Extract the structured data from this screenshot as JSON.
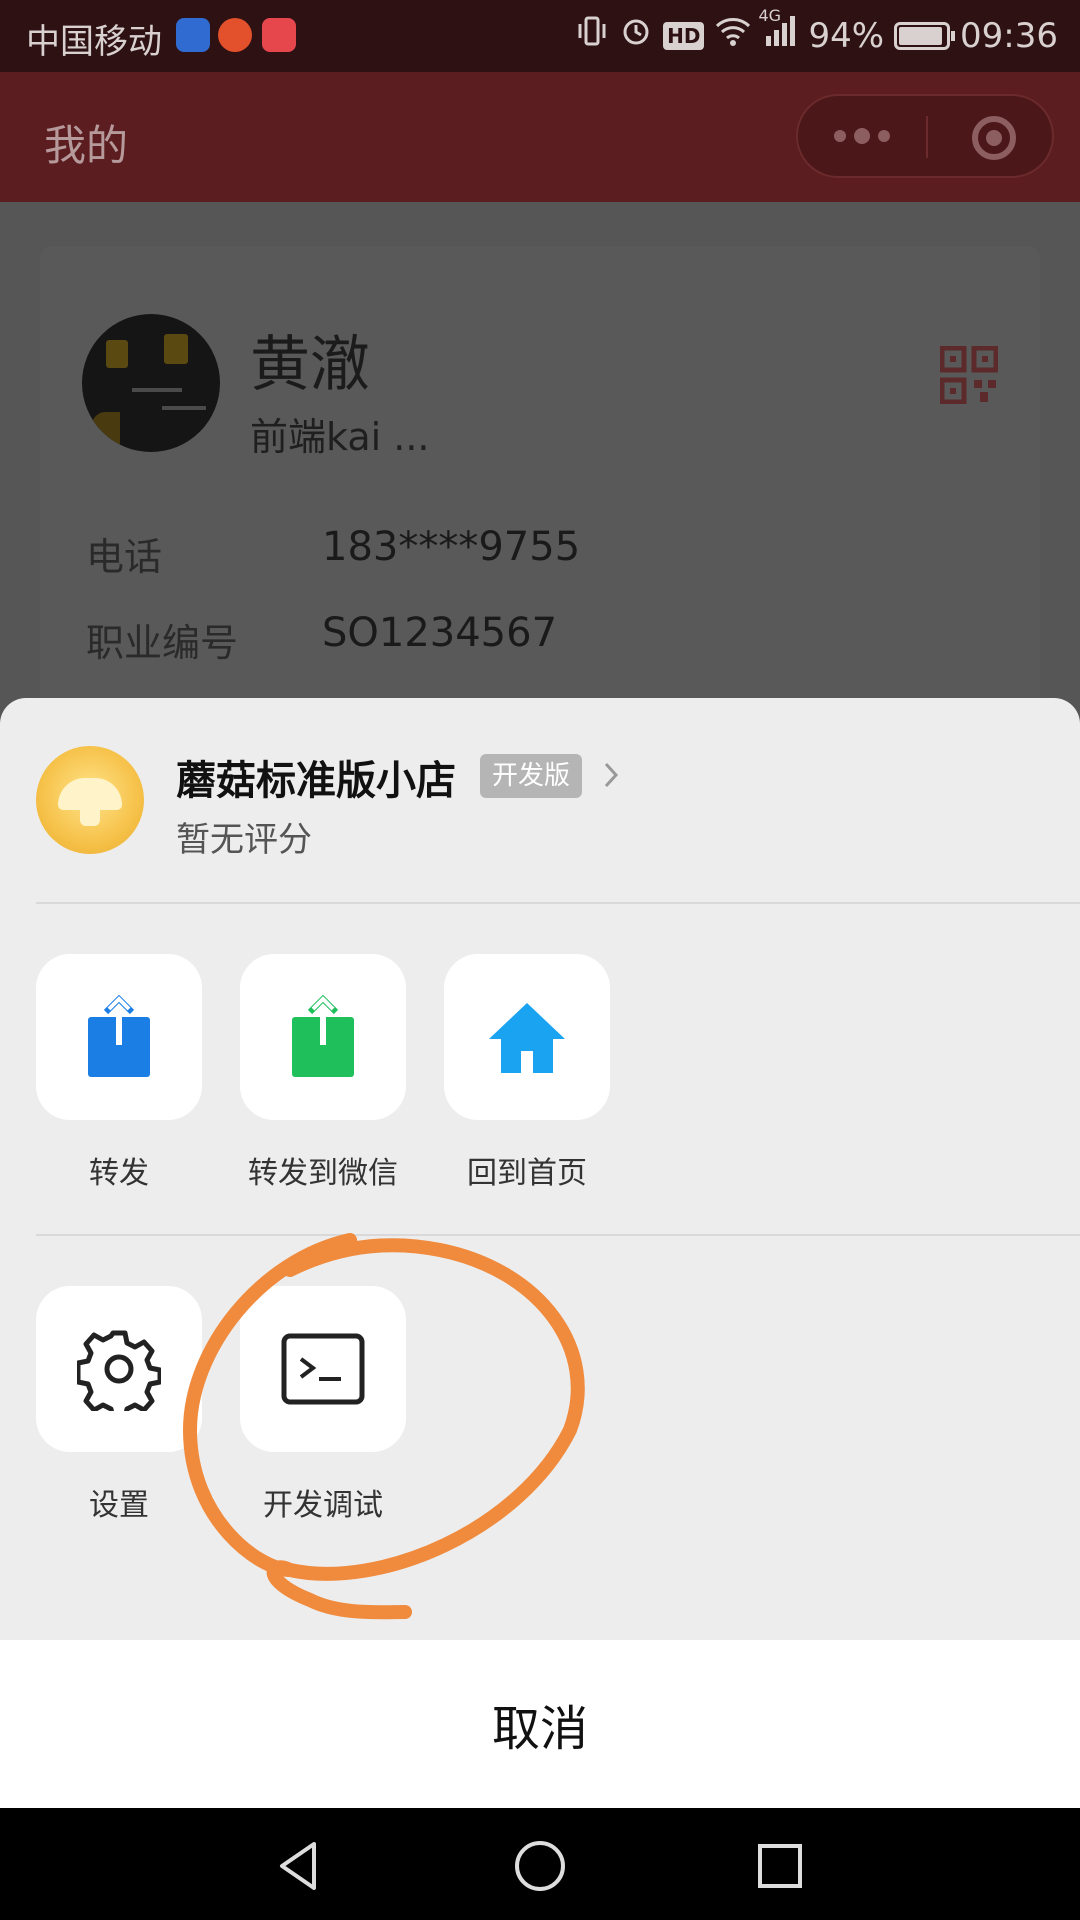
{
  "status_bar": {
    "carrier": "中国移动",
    "network": "4G",
    "battery": "94%",
    "battery_level": 0.94,
    "time": "09:36",
    "hd_label": "HD"
  },
  "nav": {
    "title": "我的"
  },
  "profile": {
    "name": "黄澈",
    "subtitle": "前端kai ...",
    "phone_label": "电话",
    "phone_value": "183****9755",
    "job_label": "职业编号",
    "job_value": "SO1234567"
  },
  "sheet": {
    "app_name": "蘑菇标准版小店",
    "badge": "开发版",
    "rating": "暂无评分",
    "row1": [
      {
        "label": "转发",
        "icon": "share-icon",
        "color": "#1a7ee5"
      },
      {
        "label": "转发到微信",
        "icon": "share-wechat-icon",
        "color": "#1fbf5c"
      },
      {
        "label": "回到首页",
        "icon": "home-icon",
        "color": "#1aa3f0"
      }
    ],
    "row2": [
      {
        "label": "设置",
        "icon": "gear-icon"
      },
      {
        "label": "开发调试",
        "icon": "terminal-icon"
      }
    ],
    "cancel": "取消"
  },
  "colors": {
    "titlebar": "#5b1d20",
    "annotation": "#f08a3c"
  }
}
